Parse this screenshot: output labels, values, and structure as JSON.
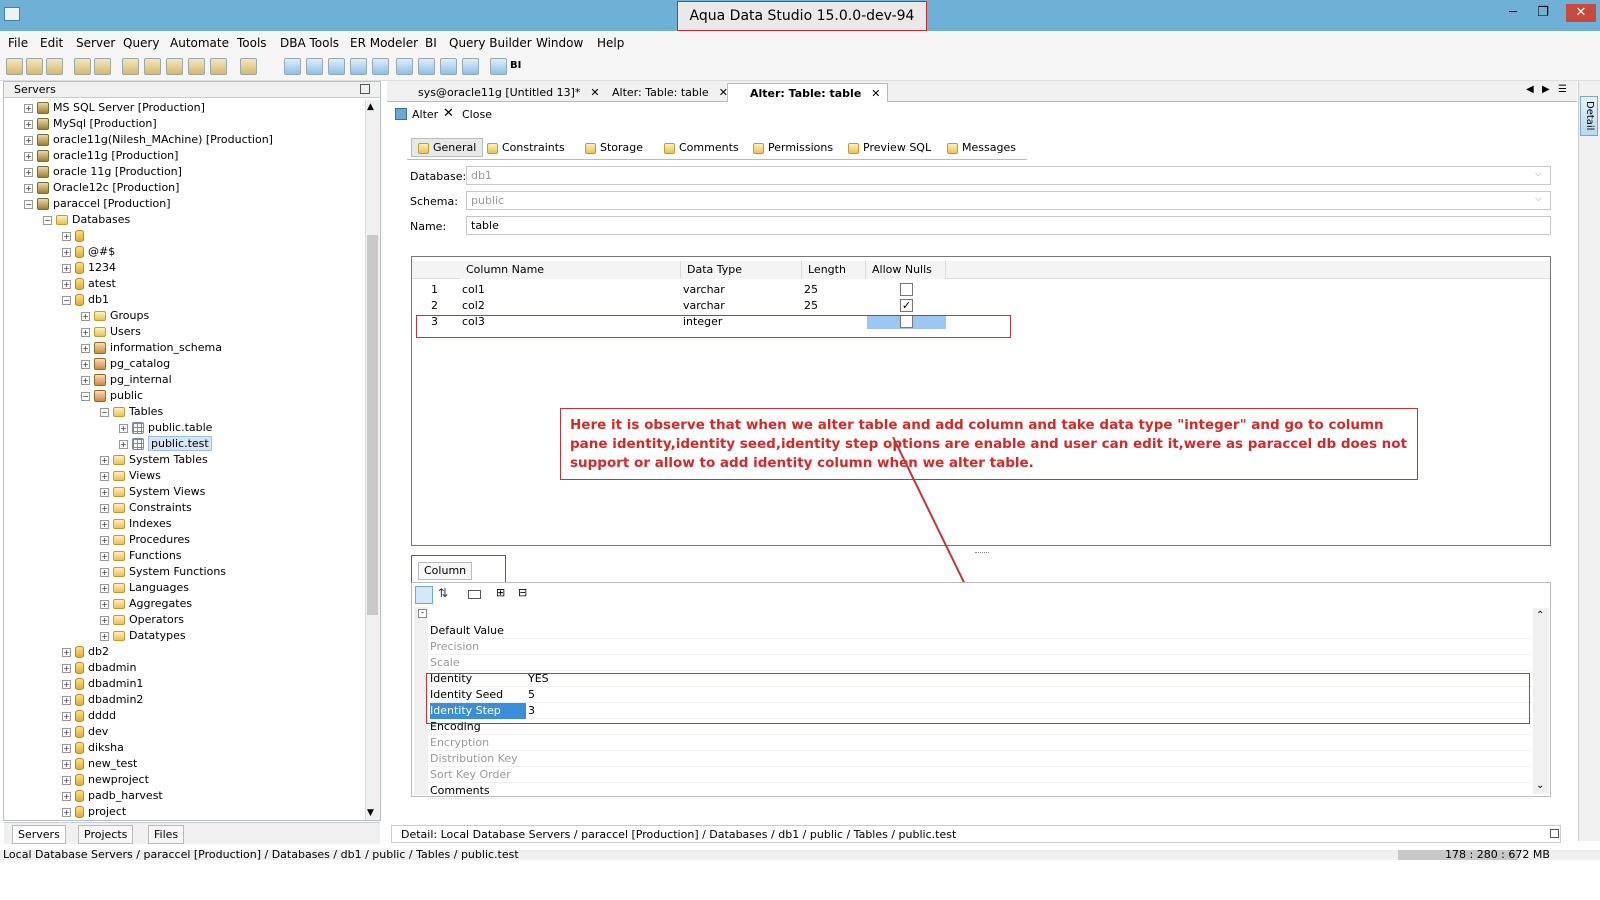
{
  "window": {
    "title": "Aqua Data Studio 15.0.0-dev-94"
  },
  "menu": [
    "File",
    "Edit",
    "Server",
    "Query",
    "Automate",
    "Tools",
    "DBA Tools",
    "ER Modeler",
    "BI",
    "Query Builder",
    "Window",
    "Help"
  ],
  "toolbar": {
    "bi_label": "BI"
  },
  "left_panel": {
    "header": "Servers",
    "tree": [
      {
        "label": "MS SQL Server [Production]",
        "icon": "server-icon",
        "level": 1,
        "expand": "+"
      },
      {
        "label": "MySql [Production]",
        "icon": "server-icon",
        "level": 1,
        "expand": "+"
      },
      {
        "label": "oracle11g(Nilesh_MAchine) [Production]",
        "icon": "server-icon",
        "level": 1,
        "expand": "+"
      },
      {
        "label": "oracle11g [Production]",
        "icon": "server-icon",
        "level": 1,
        "expand": "+"
      },
      {
        "label": "oracle 11g [Production]",
        "icon": "server-icon",
        "level": 1,
        "expand": "+"
      },
      {
        "label": "Oracle12c [Production]",
        "icon": "server-icon",
        "level": 1,
        "expand": "+"
      },
      {
        "label": "paraccel [Production]",
        "icon": "server-icon",
        "level": 1,
        "expand": "-"
      },
      {
        "label": "Databases",
        "icon": "folder-icon",
        "level": 2,
        "expand": "-"
      },
      {
        "label": "",
        "icon": "database-icon",
        "level": 3,
        "expand": "+"
      },
      {
        "label": "@#$",
        "icon": "database-icon",
        "level": 3,
        "expand": "+"
      },
      {
        "label": "1234",
        "icon": "database-icon",
        "level": 3,
        "expand": "+"
      },
      {
        "label": "atest",
        "icon": "database-icon",
        "level": 3,
        "expand": "+"
      },
      {
        "label": "db1",
        "icon": "database-icon",
        "level": 3,
        "expand": "-"
      },
      {
        "label": "Groups",
        "icon": "folder-icon",
        "level": 4,
        "expand": "+"
      },
      {
        "label": "Users",
        "icon": "folder-icon",
        "level": 4,
        "expand": "+"
      },
      {
        "label": "information_schema",
        "icon": "schema-icon",
        "level": 4,
        "expand": "+"
      },
      {
        "label": "pg_catalog",
        "icon": "schema-icon",
        "level": 4,
        "expand": "+"
      },
      {
        "label": "pg_internal",
        "icon": "schema-icon",
        "level": 4,
        "expand": "+"
      },
      {
        "label": "public",
        "icon": "schema-icon",
        "level": 4,
        "expand": "-"
      },
      {
        "label": "Tables",
        "icon": "folder-icon",
        "level": 5,
        "expand": "-"
      },
      {
        "label": "public.table",
        "icon": "table-icon",
        "level": 6,
        "expand": "+"
      },
      {
        "label": "public.test",
        "icon": "table-icon",
        "level": 6,
        "expand": "+",
        "selected": true
      },
      {
        "label": "System Tables",
        "icon": "folder-icon",
        "level": 5,
        "expand": "+"
      },
      {
        "label": "Views",
        "icon": "folder-icon",
        "level": 5,
        "expand": "+"
      },
      {
        "label": "System Views",
        "icon": "folder-icon",
        "level": 5,
        "expand": "+"
      },
      {
        "label": "Constraints",
        "icon": "folder-icon",
        "level": 5,
        "expand": "+"
      },
      {
        "label": "Indexes",
        "icon": "folder-icon",
        "level": 5,
        "expand": "+"
      },
      {
        "label": "Procedures",
        "icon": "folder-icon",
        "level": 5,
        "expand": "+"
      },
      {
        "label": "Functions",
        "icon": "folder-icon",
        "level": 5,
        "expand": "+"
      },
      {
        "label": "System Functions",
        "icon": "folder-icon",
        "level": 5,
        "expand": "+"
      },
      {
        "label": "Languages",
        "icon": "folder-icon",
        "level": 5,
        "expand": "+"
      },
      {
        "label": "Aggregates",
        "icon": "folder-icon",
        "level": 5,
        "expand": "+"
      },
      {
        "label": "Operators",
        "icon": "folder-icon",
        "level": 5,
        "expand": "+"
      },
      {
        "label": "Datatypes",
        "icon": "folder-icon",
        "level": 5,
        "expand": "+"
      },
      {
        "label": "db2",
        "icon": "database-icon",
        "level": 3,
        "expand": "+"
      },
      {
        "label": "dbadmin",
        "icon": "database-icon",
        "level": 3,
        "expand": "+"
      },
      {
        "label": "dbadmin1",
        "icon": "database-icon",
        "level": 3,
        "expand": "+"
      },
      {
        "label": "dbadmin2",
        "icon": "database-icon",
        "level": 3,
        "expand": "+"
      },
      {
        "label": "dddd",
        "icon": "database-icon",
        "level": 3,
        "expand": "+"
      },
      {
        "label": "dev",
        "icon": "database-icon",
        "level": 3,
        "expand": "+"
      },
      {
        "label": "diksha",
        "icon": "database-icon",
        "level": 3,
        "expand": "+"
      },
      {
        "label": "new_test",
        "icon": "database-icon",
        "level": 3,
        "expand": "+"
      },
      {
        "label": "newproject",
        "icon": "database-icon",
        "level": 3,
        "expand": "+"
      },
      {
        "label": "padb_harvest",
        "icon": "database-icon",
        "level": 3,
        "expand": "+"
      },
      {
        "label": "project",
        "icon": "database-icon",
        "level": 3,
        "expand": "+"
      }
    ],
    "bottom_tabs": [
      "Servers",
      "Projects",
      "Files"
    ]
  },
  "doc_tabs": [
    {
      "label": "sys@oracle11g [Untitled 13]*"
    },
    {
      "label": "Alter: Table: table"
    },
    {
      "label": "Alter: Table: table",
      "active": true
    }
  ],
  "alter_bar": {
    "alter": "Alter",
    "close": "Close"
  },
  "sub_tabs": [
    "General",
    "Constraints",
    "Storage",
    "Comments",
    "Permissions",
    "Preview SQL",
    "Messages"
  ],
  "form": {
    "database_label": "Database:",
    "database_value": "db1",
    "schema_label": "Schema:",
    "schema_value": "public",
    "name_label": "Name:",
    "name_value": "table"
  },
  "grid": {
    "headers": [
      "Column Name",
      "Data Type",
      "Length",
      "Allow Nulls"
    ],
    "rows": [
      {
        "num": "1",
        "name": "col1",
        "type": "varchar",
        "length": "25",
        "nulls": false
      },
      {
        "num": "2",
        "name": "col2",
        "type": "varchar",
        "length": "25",
        "nulls": true
      },
      {
        "num": "3",
        "name": "col3",
        "type": "integer",
        "length": "",
        "nulls": false
      }
    ]
  },
  "annotation": "Here it is observe that when we alter table and add column and take data type \"integer\" and go to column pane identity,identity seed,identity step options are enable and user can edit it,were as paraccel db does not support or allow to add identity column when we alter table.",
  "column_pane": {
    "tab": "Column",
    "props": [
      {
        "k": "Default Value",
        "v": "",
        "dis": false
      },
      {
        "k": "Precision",
        "v": "",
        "dis": true
      },
      {
        "k": "Scale",
        "v": "",
        "dis": true
      },
      {
        "k": "Identity",
        "v": "YES",
        "dis": false
      },
      {
        "k": "Identity Seed",
        "v": "5",
        "dis": false
      },
      {
        "k": "Identity Step",
        "v": "3",
        "dis": false,
        "selected": true
      },
      {
        "k": "Encoding",
        "v": "",
        "dis": false
      },
      {
        "k": "Encryption",
        "v": "",
        "dis": true
      },
      {
        "k": "Distribution Key",
        "v": "",
        "dis": true
      },
      {
        "k": "Sort Key Order",
        "v": "",
        "dis": true
      },
      {
        "k": "Comments",
        "v": "",
        "dis": false
      }
    ]
  },
  "detail_bar": "Detail: Local Database Servers / paraccel [Production] / Databases / db1 / public / Tables / public.test",
  "status_bar": {
    "path": "Local Database Servers / paraccel [Production] / Databases / db1 / public / Tables / public.test",
    "memory": "178 : 280 : 672 MB"
  },
  "right_strip": {
    "detail": "Detail"
  },
  "colors": {
    "titlebar": "#6fb1d6",
    "annotation_red": "#d62828",
    "selection": "#3b8fd9"
  }
}
